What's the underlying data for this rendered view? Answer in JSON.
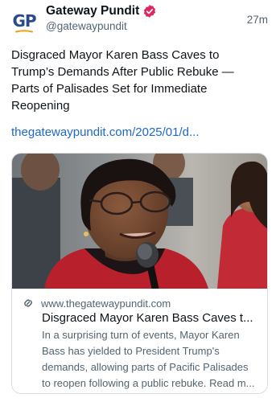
{
  "account": {
    "avatar_initials": "GP",
    "display_name": "Gateway Pundit",
    "handle": "@gatewaypundit",
    "verified_badge_icon": "verified-badge-icon",
    "timestamp": "27m"
  },
  "post": {
    "text": "Disgraced Mayor Karen Bass Caves to Trump’s Demands After Public Rebuke — Parts of Palisades Set for Immediate Reopening",
    "link_text": "thegatewaypundit.com/2025/01/d..."
  },
  "card": {
    "domain_icon": "link-icon",
    "domain": "www.thegatewaypundit.com",
    "title": "Disgraced Mayor Karen Bass Caves t...",
    "description": "In a surprising turn of events, Mayor Karen Bass has yielded to President Trump's demands, allowing parts of Pacific Palisades to reopen following a public rebuke. Read m..."
  },
  "colors": {
    "link": "#1d68c9",
    "secondary_text": "#536471",
    "verified_badge": "#e0245e",
    "avatar_text": "#2a4a8c",
    "avatar_swoosh": "#e8a21a"
  }
}
